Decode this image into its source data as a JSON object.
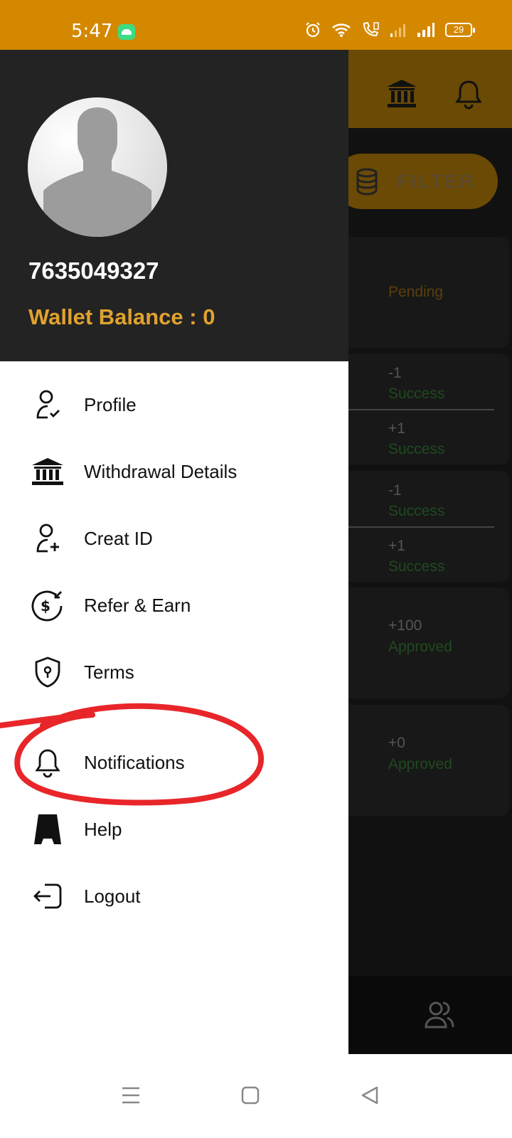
{
  "status_bar": {
    "time": "5:47",
    "battery": "29",
    "background_color": "#d48800",
    "icons": [
      "android-notification-icon",
      "alarm-icon",
      "wifi-icon",
      "volte-call-icon",
      "signal-weak-icon",
      "signal-strong-icon",
      "battery-icon"
    ]
  },
  "drawer": {
    "phone_number": "7635049327",
    "wallet_balance": "Wallet Balance : 0",
    "header_color": "#232323",
    "accent_color": "#e0a22f",
    "menu": [
      {
        "label": "Profile",
        "icon": "profile-check-icon"
      },
      {
        "label": "Withdrawal Details",
        "icon": "bank-icon"
      },
      {
        "label": "Creat ID",
        "icon": "user-add-icon"
      },
      {
        "label": "Refer & Earn",
        "icon": "dollar-refer-icon"
      },
      {
        "label": "Terms",
        "icon": "shield-icon"
      },
      {
        "label": "Notifications",
        "icon": "bell-icon"
      },
      {
        "label": "Help",
        "icon": "help-icon"
      },
      {
        "label": "Logout",
        "icon": "logout-icon"
      }
    ]
  },
  "background": {
    "filter_label": "FILTER",
    "header_icons": [
      "bank-icon",
      "bell-icon"
    ],
    "transactions": [
      {
        "status": "Pending"
      },
      {
        "amount": "-1",
        "status": "Success"
      },
      {
        "amount": "+1",
        "status": "Success"
      },
      {
        "amount": "-1",
        "status": "Success"
      },
      {
        "amount": "+1",
        "status": "Success"
      },
      {
        "amount": "+100",
        "status": "Approved"
      },
      {
        "amount": "+0",
        "status": "Approved"
      }
    ],
    "bottom_nav_icons": [
      "users-icon"
    ]
  },
  "annotation": {
    "color": "#e8262a",
    "target": "Notifications"
  },
  "nav_bar": {
    "icons": [
      "menu-icon",
      "home-icon",
      "back-icon"
    ]
  }
}
